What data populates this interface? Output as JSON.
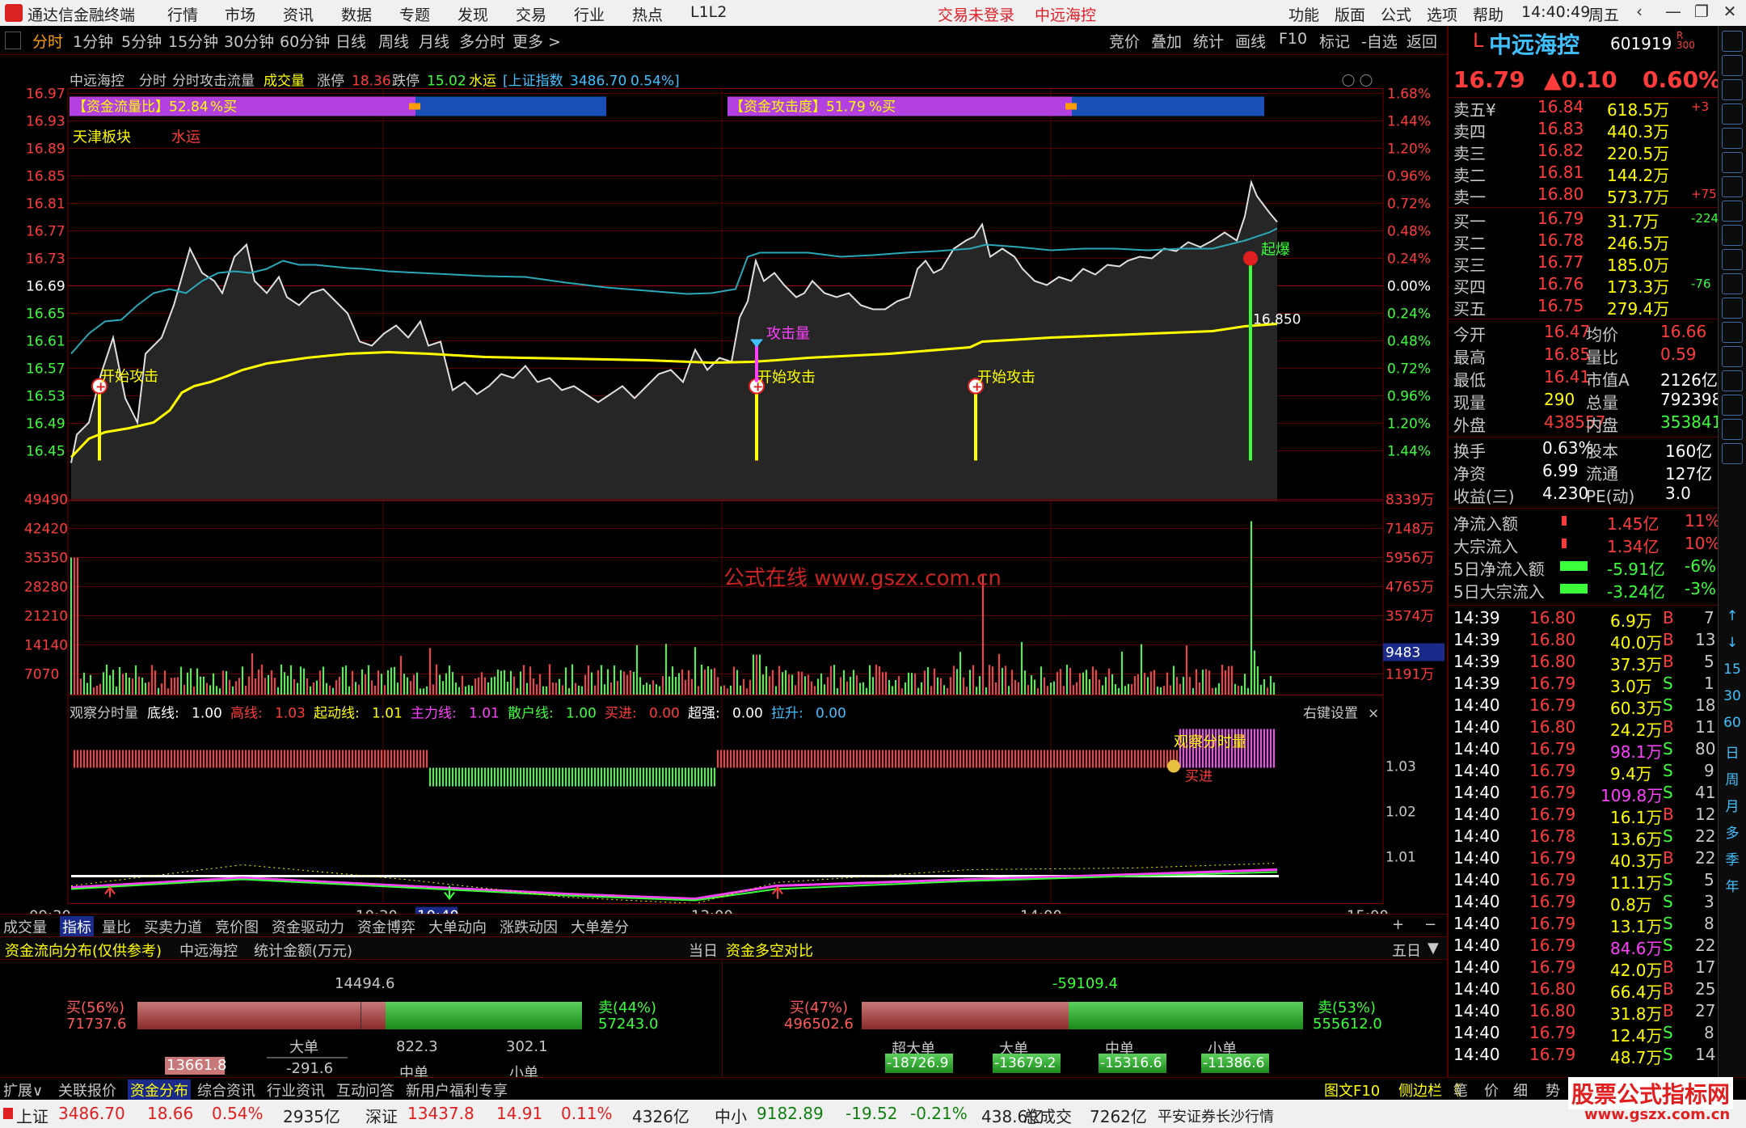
{
  "titlebar": {
    "app_name": "通达信金融终端",
    "menus": [
      "行情",
      "市场",
      "资讯",
      "数据",
      "专题",
      "发现",
      "交易",
      "行业",
      "热点",
      "L1L2"
    ],
    "alert": "交易未登录",
    "stock_name": "中远海控",
    "right_menus": [
      "功能",
      "版面",
      "公式",
      "选项",
      "帮助"
    ],
    "time": "14:40:49",
    "weekday": "周五"
  },
  "toolbar": {
    "tabs": [
      "分时",
      "1分钟",
      "5分钟",
      "15分钟",
      "30分钟",
      "60分钟",
      "日线",
      "周线",
      "月线",
      "多分时",
      "更多 >"
    ],
    "selected": "分时",
    "right_tabs": [
      "竞价",
      "叠加",
      "统计",
      "画线",
      "F10",
      "标记",
      "-自选",
      "返回"
    ]
  },
  "chart": {
    "header": {
      "name": "中远海控",
      "mode": "分时",
      "formula": "分时攻击流量",
      "vol_label": "成交量",
      "limit_up_label": "涨停",
      "limit_up": "18.36",
      "limit_down_label": "跌停",
      "limit_down": "15.02",
      "tag": "水运",
      "index_label": "[上证指数",
      "index_value": "3486.70",
      "index_pct": "0.54%]"
    },
    "bar1_label": "【资金流量比】52.84",
    "bar1_suffix": "%买",
    "bar2_label": "【资金攻击度】51.79",
    "bar2_suffix": "%买",
    "sector_label": "天津板块",
    "sector_tag": "水运",
    "price_ticks": [
      "16.97",
      "16.93",
      "16.89",
      "16.85",
      "16.81",
      "16.77",
      "16.73",
      "16.69",
      "16.65",
      "16.61",
      "16.57",
      "16.53",
      "16.49",
      "16.45"
    ],
    "pct_ticks": [
      "1.68%",
      "1.44%",
      "1.20%",
      "0.96%",
      "0.72%",
      "0.48%",
      "0.24%",
      "0.00%",
      "0.24%",
      "0.48%",
      "0.72%",
      "0.96%",
      "1.20%",
      "1.44%"
    ],
    "vol_ticks": [
      "49490",
      "42420",
      "35350",
      "28280",
      "21210",
      "14140",
      "7070"
    ],
    "vol_right_ticks": [
      "8339万",
      "7148万",
      "5956万",
      "4765万",
      "3574万",
      "",
      "1191万"
    ],
    "vol_cursor": "9483",
    "annotations": {
      "attack1": "开始攻击",
      "attack2": "开始攻击",
      "attack3": "开始攻击",
      "attack_vol": "攻击量",
      "explode": "起爆",
      "avg_price": "16.850"
    },
    "watermark": "公式在线  www.gszx.com.cn",
    "indicator": {
      "title": "观察分时量",
      "params": [
        {
          "k": "底线:",
          "v": "1.00",
          "c": "#ffffff"
        },
        {
          "k": "高线:",
          "v": "1.03",
          "c": "#ff3c3c"
        },
        {
          "k": "起动线:",
          "v": "1.01",
          "c": "#ffff00"
        },
        {
          "k": "主力线:",
          "v": "1.01",
          "c": "#ff40ff"
        },
        {
          "k": "散户线:",
          "v": "1.00",
          "c": "#3cff3c"
        },
        {
          "k": "买进:",
          "v": "0.00",
          "c": "#ff3c3c"
        },
        {
          "k": "超强:",
          "v": "0.00",
          "c": "#ffffff"
        },
        {
          "k": "拉升:",
          "v": "0.00",
          "c": "#40c0ff"
        }
      ],
      "settings": "右键设置",
      "ticks": [
        "1.03",
        "1.02",
        "1.01"
      ],
      "label_watch": "观察分时量",
      "label_buy": "买进"
    },
    "time_ticks": [
      "09:30",
      "10:30",
      "10:40",
      "13:00",
      "14:00",
      "15:00"
    ]
  },
  "bottom_tabs": [
    "成交量",
    "指标",
    "量比",
    "买卖力道",
    "竞价图",
    "资金驱动力",
    "资金博弈",
    "大单动向",
    "涨跌动因",
    "大单差分"
  ],
  "bottom_tabs_selected": "指标",
  "flow_panel": {
    "title": "资金流向分布(仅供参考)",
    "stock": "中远海控",
    "unit": "统计金额(万元)",
    "today": "当日",
    "left": {
      "net": "14494.6",
      "buy_label": "买(56%)",
      "buy_value": "71737.6",
      "sell_label": "卖(44%)",
      "sell_value": "57243.0",
      "big_label": "大单",
      "big_value": "822.3",
      "big_neg": "-291.6",
      "mid_value": "302.1",
      "mid_label": "中单",
      "small_label": "小单",
      "huge_value": "13661.8"
    },
    "right_title": "资金多空对比",
    "right_days": "五日",
    "right": {
      "net": "-59109.4",
      "buy_label": "买(47%)",
      "buy_value": "496502.6",
      "sell_label": "卖(53%)",
      "sell_value": "555612.0",
      "cats": [
        "超大单",
        "大单",
        "中单",
        "小单"
      ],
      "vals": [
        "-18726.9",
        "-13679.2",
        "-15316.6",
        "-11386.6"
      ]
    }
  },
  "bottom_nav": [
    "扩展∨",
    "关联报价",
    "资金分布",
    "综合资讯",
    "行业资讯",
    "互动问答",
    "新用户福利专享"
  ],
  "bottom_nav_selected": "资金分布",
  "bottom_nav_right": [
    "图文F10",
    "侧边栏 《",
    "笔",
    "价",
    "细",
    "势",
    "联"
  ],
  "status": [
    {
      "name": "上证",
      "value": "3486.70",
      "chg": "18.66",
      "pct": "0.54%",
      "amt": "2935亿",
      "up": true
    },
    {
      "name": "深证",
      "value": "13437.8",
      "chg": "14.91",
      "pct": "0.11%",
      "amt": "4326亿",
      "up": true
    },
    {
      "name": "中小",
      "value": "9182.89",
      "chg": "-19.52",
      "pct": "-0.21%",
      "amt": "438.6亿",
      "up": false
    }
  ],
  "status_total_label": "总成交",
  "status_total": "7262亿",
  "status_broker": "平安证券长沙行情",
  "status_brand": "股票公式指标网",
  "status_brand_url": "www.gszx.com.cn",
  "quote": {
    "marker": "L",
    "name": "中远海控",
    "code": "601919",
    "badges": "R 300",
    "price": "16.79",
    "change": "▲0.10",
    "pct": "0.60%",
    "asks": [
      {
        "label": "卖五¥",
        "price": "16.84",
        "vol": "618.5万",
        "chg": "+3"
      },
      {
        "label": "卖四",
        "price": "16.83",
        "vol": "440.3万",
        "chg": ""
      },
      {
        "label": "卖三",
        "price": "16.82",
        "vol": "220.5万",
        "chg": ""
      },
      {
        "label": "卖二",
        "price": "16.81",
        "vol": "144.2万",
        "chg": ""
      },
      {
        "label": "卖一",
        "price": "16.80",
        "vol": "573.7万",
        "chg": "+75"
      }
    ],
    "bids": [
      {
        "label": "买一",
        "price": "16.79",
        "vol": "31.7万",
        "chg": "-224"
      },
      {
        "label": "买二",
        "price": "16.78",
        "vol": "246.5万",
        "chg": ""
      },
      {
        "label": "买三",
        "price": "16.77",
        "vol": "185.0万",
        "chg": ""
      },
      {
        "label": "买四",
        "price": "16.76",
        "vol": "173.3万",
        "chg": "-76"
      },
      {
        "label": "买五",
        "price": "16.75",
        "vol": "279.4万",
        "chg": ""
      }
    ],
    "stats": [
      {
        "l1": "今开",
        "v1": "16.47",
        "l2": "均价",
        "v2": "16.66"
      },
      {
        "l1": "最高",
        "v1": "16.85",
        "l2": "量比",
        "v2": "0.59"
      },
      {
        "l1": "最低",
        "v1": "16.41",
        "l2": "市值A",
        "v2": "2126亿"
      },
      {
        "l1": "现量",
        "v1": "290",
        "l2": "总量",
        "v2": "792398"
      },
      {
        "l1": "外盘",
        "v1": "438557",
        "l2": "内盘",
        "v2": "353841"
      }
    ],
    "stats2": [
      {
        "l1": "换手",
        "v1": "0.63%",
        "l2": "股本",
        "v2": "160亿"
      },
      {
        "l1": "净资",
        "v1": "6.99",
        "l2": "流通",
        "v2": "127亿"
      },
      {
        "l1": "收益(三)",
        "v1": "4.230",
        "l2": "PE(动)",
        "v2": "3.0"
      }
    ],
    "flows": [
      {
        "label": "净流入额",
        "value": "1.45亿",
        "pct": "11%"
      },
      {
        "label": "大宗流入",
        "value": "1.34亿",
        "pct": "10%"
      },
      {
        "label": "5日净流入额",
        "value": "-5.91亿",
        "pct": "-6%"
      },
      {
        "label": "5日大宗流入",
        "value": "-3.24亿",
        "pct": "-3%"
      }
    ],
    "ticks": [
      [
        "14:39",
        "16.80",
        "6.9万",
        "B",
        "7"
      ],
      [
        "14:39",
        "16.80",
        "40.0万",
        "B",
        "13"
      ],
      [
        "14:39",
        "16.80",
        "37.3万",
        "B",
        "5"
      ],
      [
        "14:39",
        "16.79",
        "3.0万",
        "S",
        "1"
      ],
      [
        "14:40",
        "16.79",
        "60.3万",
        "S",
        "18"
      ],
      [
        "14:40",
        "16.80",
        "24.2万",
        "B",
        "11"
      ],
      [
        "14:40",
        "16.79",
        "98.1万",
        "S",
        "80"
      ],
      [
        "14:40",
        "16.79",
        "9.4万",
        "S",
        "9"
      ],
      [
        "14:40",
        "16.79",
        "109.8万",
        "S",
        "41"
      ],
      [
        "14:40",
        "16.79",
        "16.1万",
        "B",
        "12"
      ],
      [
        "14:40",
        "16.78",
        "13.6万",
        "S",
        "22"
      ],
      [
        "14:40",
        "16.79",
        "40.3万",
        "B",
        "22"
      ],
      [
        "14:40",
        "16.79",
        "11.1万",
        "S",
        "5"
      ],
      [
        "14:40",
        "16.79",
        "0.8万",
        "S",
        "3"
      ],
      [
        "14:40",
        "16.79",
        "13.1万",
        "S",
        "8"
      ],
      [
        "14:40",
        "16.79",
        "84.6万",
        "S",
        "22"
      ],
      [
        "14:40",
        "16.79",
        "42.0万",
        "B",
        "17"
      ],
      [
        "14:40",
        "16.80",
        "66.4万",
        "B",
        "25"
      ],
      [
        "14:40",
        "16.80",
        "31.8万",
        "B",
        "27"
      ],
      [
        "14:40",
        "16.79",
        "12.4万",
        "S",
        "8"
      ],
      [
        "14:40",
        "16.79",
        "48.7万",
        "S",
        "14"
      ]
    ]
  },
  "sidebar_items": [
    "↑",
    "↓",
    "15",
    "30",
    "60",
    "日",
    "周",
    "月",
    "多",
    "季",
    "年"
  ]
}
